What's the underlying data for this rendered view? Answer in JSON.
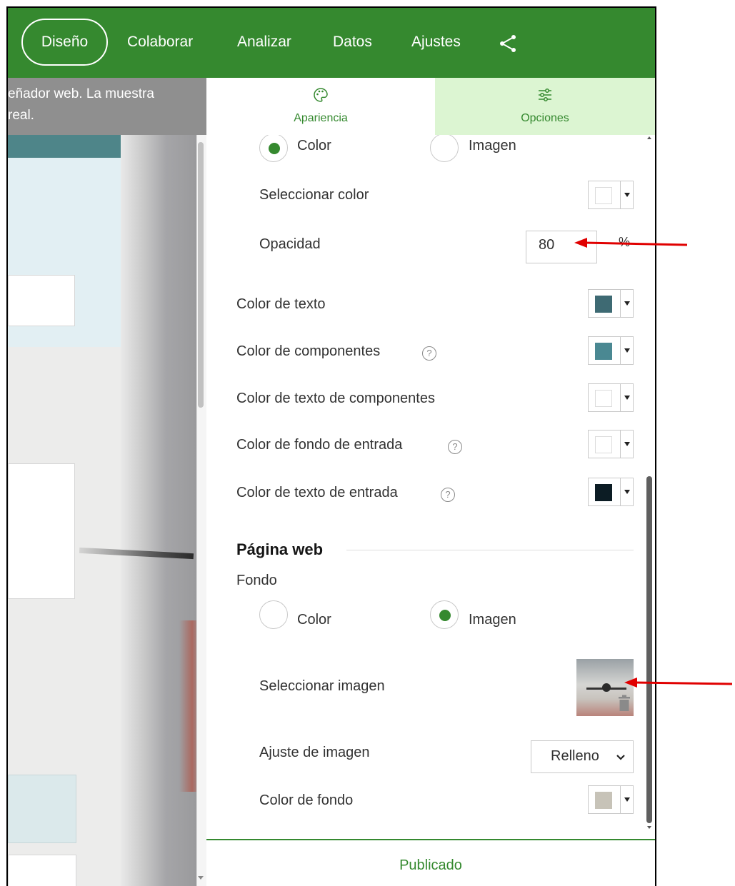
{
  "nav": {
    "items": [
      {
        "label": "Diseño",
        "active": true
      },
      {
        "label": "Colaborar"
      },
      {
        "label": "Analizar"
      },
      {
        "label": "Datos"
      },
      {
        "label": "Ajustes"
      }
    ],
    "share_icon": "share-icon"
  },
  "preview": {
    "notice_line1": "eñador web. La muestra",
    "notice_line2": "real."
  },
  "tabs": [
    {
      "label": "Apariencia",
      "icon": "palette-icon",
      "active": true
    },
    {
      "label": "Opciones",
      "icon": "sliders-icon",
      "active": false
    }
  ],
  "form": {
    "background_type": {
      "color_label": "Color",
      "image_label": "Imagen",
      "selected": "Color"
    },
    "select_color_label": "Seleccionar color",
    "select_color_value": "#ffffff",
    "opacity_label": "Opacidad",
    "opacity_value": "80",
    "opacity_unit": "%",
    "text_color_label": "Color de texto",
    "text_color_value": "#3e6a73",
    "components_color_label": "Color de componentes",
    "components_color_value": "#4a8892",
    "components_text_color_label": "Color de texto de componentes",
    "components_text_color_value": "#ffffff",
    "input_bg_color_label": "Color de fondo de entrada",
    "input_bg_color_value": "#ffffff",
    "input_text_color_label": "Color de texto de entrada",
    "input_text_color_value": "#0c1c24",
    "help_glyph": "?"
  },
  "webpage": {
    "title": "Página web",
    "background_label": "Fondo",
    "background_type": {
      "color_label": "Color",
      "image_label": "Imagen",
      "selected": "Imagen"
    },
    "select_image_label": "Seleccionar imagen",
    "image_fit_label": "Ajuste de imagen",
    "image_fit_value": "Relleno",
    "bg_color_label": "Color de fondo",
    "bg_color_value": "#c7c3b8"
  },
  "footer": {
    "status": "Publicado"
  },
  "colors": {
    "brand_green": "#35892f",
    "tab_inactive_bg": "#dcf5d2",
    "annotation_red": "#e00000"
  }
}
